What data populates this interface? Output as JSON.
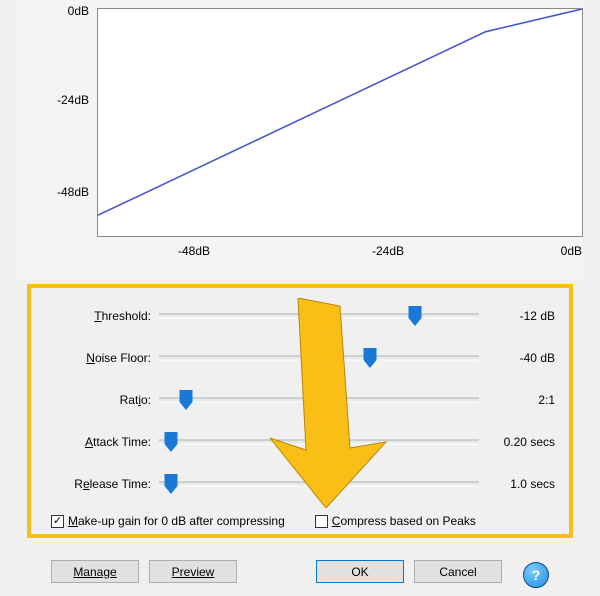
{
  "chart_data": {
    "type": "line",
    "title": "",
    "xlabel": "",
    "ylabel": "",
    "xlim": [
      -60,
      0
    ],
    "ylim": [
      -60,
      0
    ],
    "x_ticks_visible": [
      "-48dB",
      "-24dB",
      "0dB"
    ],
    "y_ticks_visible": [
      "0dB",
      "-24dB",
      "-48dB"
    ],
    "series": [
      {
        "name": "compression-curve",
        "color": "#4b58cc",
        "x": [
          -60,
          -12,
          0
        ],
        "y": [
          -54.4,
          -6,
          0
        ]
      }
    ]
  },
  "sliders": {
    "threshold": {
      "label_pre": "",
      "label_u": "T",
      "label_post": "hreshold:",
      "value": "-12 dB",
      "pos": 0.8
    },
    "noise": {
      "label_pre": "",
      "label_u": "N",
      "label_post": "oise Floor:",
      "value": "-40 dB",
      "pos": 0.66
    },
    "ratio": {
      "label_pre": "Rat",
      "label_u": "i",
      "label_post": "o:",
      "value": "2:1",
      "pos": 0.085
    },
    "attack": {
      "label_pre": "",
      "label_u": "A",
      "label_post": "ttack Time:",
      "value": "0.20 secs",
      "pos": 0.038
    },
    "release": {
      "label_pre": "R",
      "label_u": "e",
      "label_post": "lease Time:",
      "value": "1.0 secs",
      "pos": 0.038
    }
  },
  "checkboxes": {
    "makeup": {
      "label_pre": "",
      "label_u": "M",
      "label_post": "ake-up gain for 0 dB after compressing",
      "checked": true
    },
    "peaks": {
      "label_pre": "",
      "label_u": "C",
      "label_post": "ompress based on Peaks",
      "checked": false
    }
  },
  "buttons": {
    "manage": "Manage",
    "preview": "Preview",
    "ok": "OK",
    "cancel": "Cancel",
    "help": "?"
  }
}
